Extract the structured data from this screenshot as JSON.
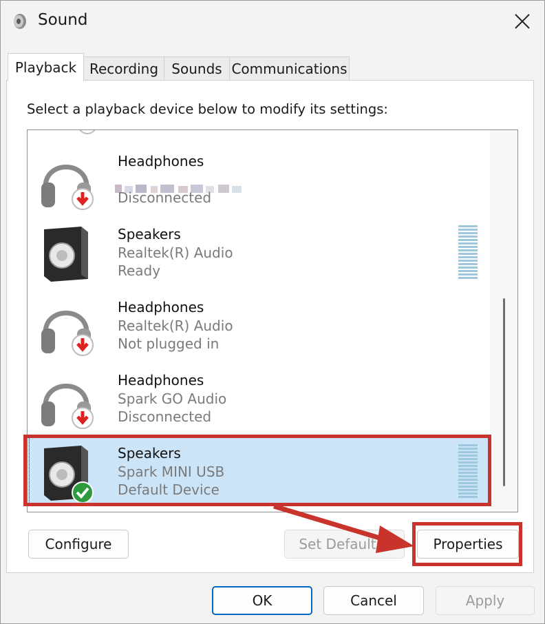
{
  "window": {
    "title": "Sound",
    "close_icon": "close-icon"
  },
  "tabs": [
    {
      "label": "Playback",
      "active": true
    },
    {
      "label": "Recording",
      "active": false
    },
    {
      "label": "Sounds",
      "active": false
    },
    {
      "label": "Communications",
      "active": false
    }
  ],
  "instructions": "Select a playback device below to modify its settings:",
  "devices": [
    {
      "name": "Headphones",
      "line1": "",
      "status": "Disconnected",
      "icon": "headphones-disconnected-icon"
    },
    {
      "name": "Speakers",
      "line1": "Realtek(R) Audio",
      "status": "Ready",
      "icon": "speaker-icon"
    },
    {
      "name": "Headphones",
      "line1": "Realtek(R) Audio",
      "status": "Not plugged in",
      "icon": "headphones-disconnected-icon"
    },
    {
      "name": "Headphones",
      "line1": "Spark GO Audio",
      "status": "Disconnected",
      "icon": "headphones-disconnected-icon"
    },
    {
      "name": "Speakers",
      "line1": "Spark MINI USB",
      "status": "Default Device",
      "icon": "speaker-default-icon",
      "selected": true
    }
  ],
  "buttons": {
    "configure": "Configure",
    "set_default": "Set Default",
    "properties": "Properties",
    "ok": "OK",
    "cancel": "Cancel",
    "apply": "Apply"
  },
  "colors": {
    "highlight": "#c8332b",
    "selection": "#cce4f7",
    "accent": "#0067c0"
  }
}
